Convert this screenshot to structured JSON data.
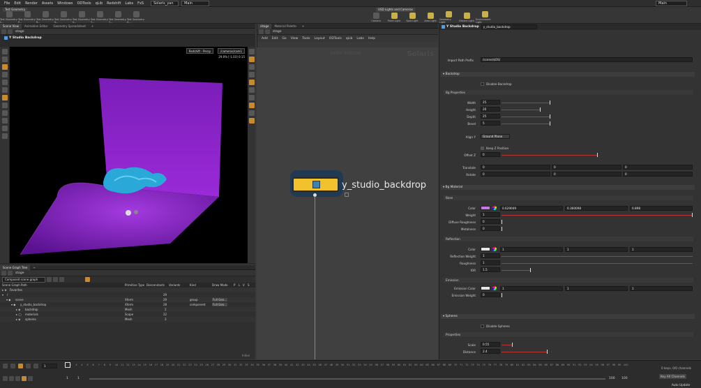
{
  "menubar": {
    "items": [
      "File",
      "Edit",
      "Render",
      "Assets",
      "Windows",
      "ODTools",
      "qLib",
      "Redshift",
      "Labs",
      "FxS"
    ],
    "desktop": "Solaris_yan",
    "context": "Main",
    "right_dropdown": "Main"
  },
  "shelf": {
    "tab": "Test Geometry",
    "tools": [
      "Test Geometry: C...",
      "Test Geometry: P...",
      "Test Geometry: R...",
      "Test Geometry: S...",
      "Test Geometry: S...",
      "Test Geometry: T...",
      "Test Geometry: T...",
      "Test Geometry: Z..."
    ],
    "right_tab": "USD Lights and Cameras",
    "right_tools": [
      "Camera",
      "Point Light",
      "Spot Light",
      "Area Light",
      "Geometry Light",
      "Distant Light",
      "Environment Light"
    ]
  },
  "viewport_pane": {
    "tabs": [
      "Scene View",
      "Animation Editor",
      "Geometry Spreadsheet"
    ],
    "path": "stage",
    "title": "Y Studio Backdrop",
    "renderer": "Redshift - Persp",
    "camera": "/cameras/cam1",
    "stats": "29.0%  [-1.03]  0:15"
  },
  "scene_graph": {
    "tab": "Scene Graph Tree",
    "path": "stage",
    "mode": "Composed scene graph",
    "headers": [
      "Scene Graph Path",
      "Primitive Type",
      "Descendants",
      "Variants",
      "Kind",
      "Draw Mode",
      "P",
      "L",
      "V",
      "S"
    ],
    "rows": [
      {
        "name": "Favorites",
        "type": "",
        "desc": "",
        "kind": "",
        "draw": ""
      },
      {
        "name": "/",
        "type": "",
        "desc": "29",
        "kind": "",
        "draw": ""
      },
      {
        "name": "scene",
        "type": "Xform",
        "desc": "29",
        "kind": "group",
        "draw": "Full Geo..."
      },
      {
        "name": "y_studio_backdrop",
        "type": "Xform",
        "desc": "28",
        "kind": "component",
        "draw": "Full Geo..."
      },
      {
        "name": "backdrop",
        "type": "Mesh",
        "desc": "2",
        "kind": "",
        "draw": ""
      },
      {
        "name": "materials",
        "type": "Scope",
        "desc": "22",
        "kind": "",
        "draw": ""
      },
      {
        "name": "spheres",
        "type": "Mesh",
        "desc": "3",
        "kind": "",
        "draw": ""
      }
    ],
    "footer": "Inline"
  },
  "network": {
    "tabs": [
      "/stage",
      "Material Palette"
    ],
    "path": "stage",
    "menu": [
      "Add",
      "Edit",
      "Go",
      "View",
      "Tools",
      "Layout",
      "ODTools",
      "qLib",
      "Labs",
      "Help"
    ],
    "watermark_edition": "Indie Edition",
    "watermark_context": "Solaris",
    "node_name": "y_studio_backdrop"
  },
  "params": {
    "node_type": "Y Studio Backdrop",
    "node_name": "y_studio_backdrop",
    "import_path_label": "Import Path Prefix",
    "import_path_value": "/scene/$OS/",
    "backdrop_section": "Backdrop",
    "disable_backdrop": "Disable Backdrop",
    "bg_properties": "Bg Properties",
    "width_label": "Width",
    "width_value": "25",
    "height_label": "Height",
    "height_value": "20",
    "depth_label": "Depth",
    "depth_value": "25",
    "bevel_label": "Bevel",
    "bevel_value": "5",
    "align_label": "Align Y",
    "align_value": "Ground Plane",
    "keep_z": "Keep Z Position",
    "offset_label": "Offset Z",
    "offset_value": "0",
    "translate_label": "Translate",
    "translate": [
      "0",
      "0",
      "0"
    ],
    "rotate_label": "Rotate",
    "rotate": [
      "0",
      "0",
      "0"
    ],
    "bg_material": "Bg Material",
    "base": "Base",
    "color_label": "Color",
    "color": [
      "0.629049",
      "0.360098",
      "0.898"
    ],
    "weight_label": "Weight",
    "weight_value": "1",
    "diffuse_label": "Diffuse Roughness",
    "diffuse_value": "0",
    "metalness_label": "Metalness",
    "metalness_value": "0",
    "reflection": "Reflection",
    "refl_color_label": "Color",
    "refl_color": [
      "1",
      "1",
      "1"
    ],
    "refl_weight_label": "Reflection Weight",
    "refl_weight_value": "1",
    "roughness_label": "Roughness",
    "roughness_value": "1",
    "ior_label": "IOR",
    "ior_value": "1.5",
    "emission": "Emission",
    "emission_color_label": "Emission Color",
    "emission_color": [
      "1",
      "1",
      "1"
    ],
    "emission_weight_label": "Emission Weight",
    "emission_weight_value": "0",
    "spheres_section": "Spheres",
    "disable_spheres": "Disable Spheres",
    "properties": "Properties",
    "scale_label": "Scale",
    "scale_value": "0.55",
    "distance_label": "Distance",
    "distance_value": "2.4"
  },
  "timeline": {
    "frame": "1",
    "start": "1",
    "start2": "1",
    "end": "100",
    "end2": "100",
    "keys": "0 keys, 0/0 channels",
    "key_all": "Key All Channels",
    "auto_update": "Auto Update",
    "ticks": [
      "1",
      "2",
      "3",
      "4",
      "5",
      "6",
      "7",
      "8",
      "9",
      "10",
      "11",
      "12",
      "13",
      "14",
      "15",
      "16",
      "17",
      "18",
      "19",
      "20",
      "21",
      "22",
      "23",
      "24",
      "25",
      "26",
      "27",
      "28",
      "29",
      "30",
      "31",
      "32",
      "33",
      "34",
      "35",
      "36",
      "37",
      "38",
      "39",
      "40",
      "41",
      "42",
      "43",
      "44",
      "45",
      "46",
      "47",
      "48",
      "49",
      "50",
      "51",
      "52",
      "53",
      "54",
      "55",
      "56",
      "57",
      "58",
      "59",
      "60",
      "61",
      "62",
      "63",
      "64",
      "65",
      "66",
      "67",
      "68",
      "69",
      "70",
      "71",
      "72",
      "73",
      "74",
      "75",
      "76",
      "77",
      "78",
      "79",
      "80",
      "81",
      "82",
      "83",
      "84",
      "85",
      "86",
      "87",
      "88",
      "89",
      "90",
      "91",
      "92",
      "93",
      "94",
      "95",
      "96",
      "97",
      "98",
      "99",
      "100"
    ]
  },
  "colors": {
    "backdrop_purple": "#8f1fd0",
    "node_yellow": "#f2c12e",
    "accent_orange": "#c98a2c",
    "base_color_swatch": "#c878e2"
  }
}
